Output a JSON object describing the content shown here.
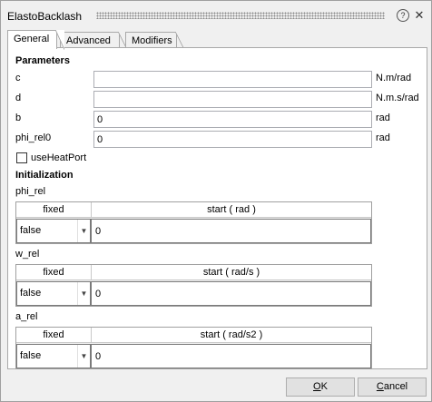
{
  "window": {
    "title": "ElastoBacklash"
  },
  "tabs": [
    {
      "label": "General",
      "active": true
    },
    {
      "label": "Advanced",
      "active": false
    },
    {
      "label": "Modifiers",
      "active": false
    }
  ],
  "parameters": {
    "title": "Parameters",
    "rows": [
      {
        "label": "c",
        "value": "",
        "unit": "N.m/rad"
      },
      {
        "label": "d",
        "value": "",
        "unit": "N.m.s/rad"
      },
      {
        "label": "b",
        "value": "0",
        "unit": "rad"
      },
      {
        "label": "phi_rel0",
        "value": "0",
        "unit": "rad"
      }
    ],
    "use_heat_port": {
      "label": "useHeatPort",
      "checked": false
    }
  },
  "initialization": {
    "title": "Initialization",
    "groups": [
      {
        "label": "phi_rel",
        "fixed_header": "fixed",
        "start_header": "start ( rad )",
        "fixed_value": "false",
        "start_value": "0"
      },
      {
        "label": "w_rel",
        "fixed_header": "fixed",
        "start_header": "start ( rad/s )",
        "fixed_value": "false",
        "start_value": "0"
      },
      {
        "label": "a_rel",
        "fixed_header": "fixed",
        "start_header": "start ( rad/s2 )",
        "fixed_value": "false",
        "start_value": "0"
      }
    ]
  },
  "buttons": {
    "ok": {
      "underline": "O",
      "rest": "K"
    },
    "cancel": {
      "underline": "C",
      "rest": "ancel"
    }
  },
  "icons": {
    "help": "?",
    "close": "✕",
    "dropdown": "▼"
  }
}
